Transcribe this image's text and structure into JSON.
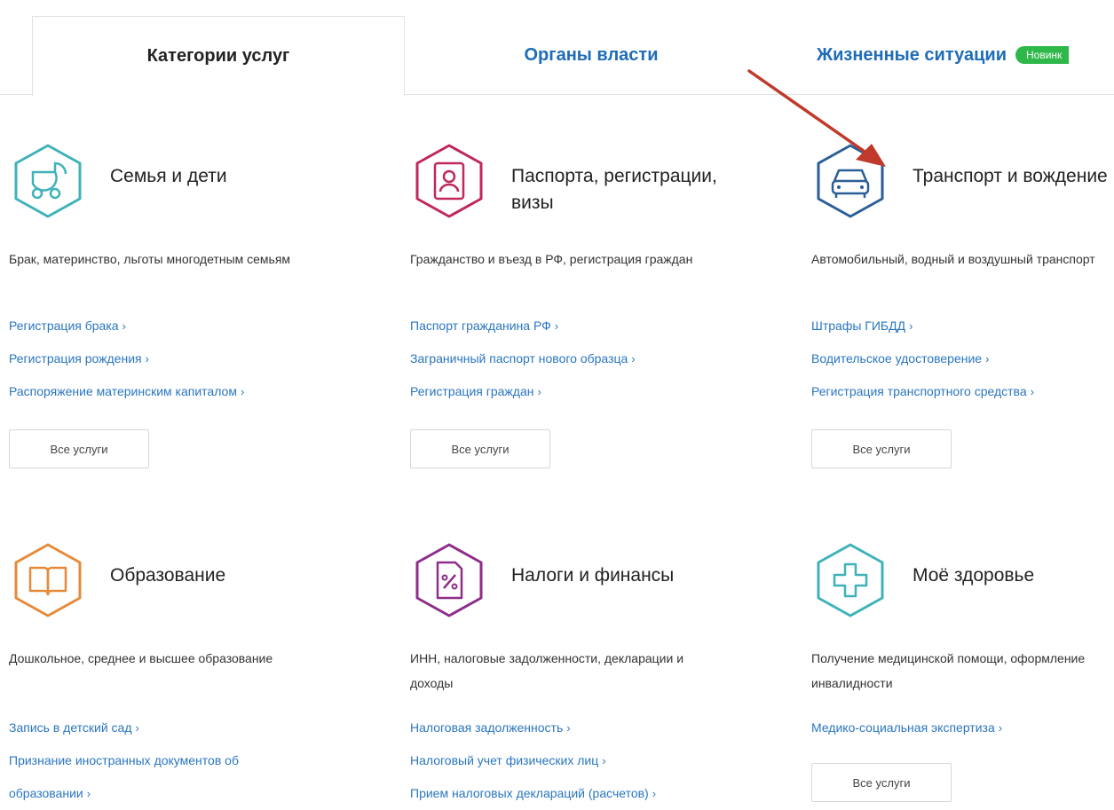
{
  "tabs": {
    "categories": "Категории услуг",
    "authorities": "Органы власти",
    "life_situations": "Жизненные ситуации",
    "new_badge": "Новинк"
  },
  "colors": {
    "link": "#2a76c0",
    "tab_link": "#1e6cb8",
    "badge": "#2fb84a",
    "annotation_arrow": "#c0392b"
  },
  "cards": [
    {
      "icon": "baby-stroller-icon",
      "color": "#3fb2b9",
      "title": "Семья и дети",
      "description": "Брак, материнство, льготы многодетным семьям",
      "links": [
        "Регистрация брака",
        "Регистрация рождения",
        "Распоряжение материнским капиталом"
      ],
      "button": "Все услуги"
    },
    {
      "icon": "passport-icon",
      "color": "#c0275a",
      "title": "Паспорта, регистрации, визы",
      "description": "Гражданство и въезд в РФ, регистрация граждан",
      "links": [
        "Паспорт гражданина РФ",
        "Заграничный паспорт нового образца",
        "Регистрация граждан"
      ],
      "button": "Все услуги"
    },
    {
      "icon": "car-icon",
      "color": "#2a5f97",
      "title": "Транспорт и вождение",
      "description": "Автомобильный, водный и воздушный транспорт",
      "links": [
        "Штрафы ГИБДД",
        "Водительское удостоверение",
        "Регистрация транспортного средства"
      ],
      "button": "Все услуги"
    },
    {
      "icon": "book-icon",
      "color": "#e58a3a",
      "title": "Образование",
      "description": "Дошкольное, среднее и высшее образование",
      "links": [
        "Запись в детский сад",
        "Признание иностранных документов об образовании"
      ]
    },
    {
      "icon": "tax-document-icon",
      "color": "#8e2d8a",
      "title": "Налоги и финансы",
      "description": "ИНН, налоговые задолженности, декларации и доходы",
      "links": [
        "Налоговая задолженность",
        "Налоговый учет физических лиц",
        "Прием налоговых деклараций (расчетов)"
      ]
    },
    {
      "icon": "medical-cross-icon",
      "color": "#3fb2b9",
      "title": "Моё здоровье",
      "description": "Получение медицинской помощи, оформление инвалидности",
      "links": [
        "Медико-социальная экспертиза"
      ],
      "button": "Все услуги"
    }
  ],
  "chevron": "›"
}
